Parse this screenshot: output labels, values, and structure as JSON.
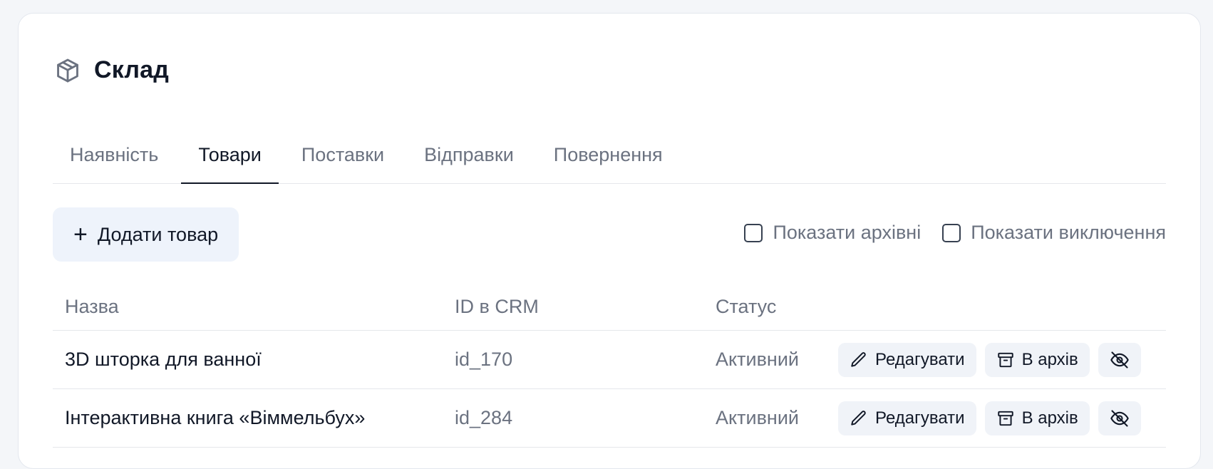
{
  "header": {
    "title": "Склад",
    "icon": "package-icon"
  },
  "tabs": [
    {
      "label": "Наявність",
      "active": false
    },
    {
      "label": "Товари",
      "active": true
    },
    {
      "label": "Поставки",
      "active": false
    },
    {
      "label": "Відправки",
      "active": false
    },
    {
      "label": "Повернення",
      "active": false
    }
  ],
  "toolbar": {
    "add_label": "Додати товар",
    "show_archived_label": "Показати архівні",
    "show_archived_checked": false,
    "show_excluded_label": "Показати виключення",
    "show_excluded_checked": false
  },
  "table": {
    "columns": [
      "Назва",
      "ID в CRM",
      "Статус"
    ],
    "rows": [
      {
        "name": "3D шторка для ванної",
        "crm_id": "id_170",
        "status": "Активний"
      },
      {
        "name": "Інтерактивна книга «Віммельбух»",
        "crm_id": "id_284",
        "status": "Активний"
      }
    ],
    "actions": {
      "edit_label": "Редагувати",
      "archive_label": "В архів"
    }
  },
  "colors": {
    "accent_bg": "#eef3fb",
    "muted_text": "#6b7280",
    "primary_text": "#111827"
  }
}
